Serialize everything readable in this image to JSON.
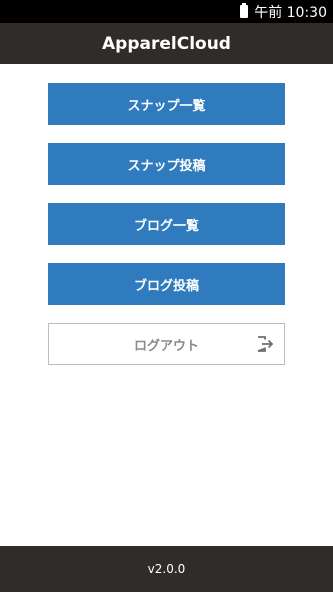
{
  "status_bar": {
    "time": "午前 10:30",
    "battery_icon": "battery-icon"
  },
  "app_bar": {
    "title": "ApparelCloud"
  },
  "menu": {
    "items": [
      {
        "label": "スナップ一覧"
      },
      {
        "label": "スナップ投稿"
      },
      {
        "label": "ブログ一覧"
      },
      {
        "label": "ブログ投稿"
      }
    ],
    "logout": {
      "label": "ログアウト",
      "icon": "logout-icon"
    }
  },
  "footer": {
    "version": "v2.0.0"
  },
  "colors": {
    "primary": "#2f7bbe",
    "bar": "#2f2c29",
    "status_bar": "#000000"
  }
}
